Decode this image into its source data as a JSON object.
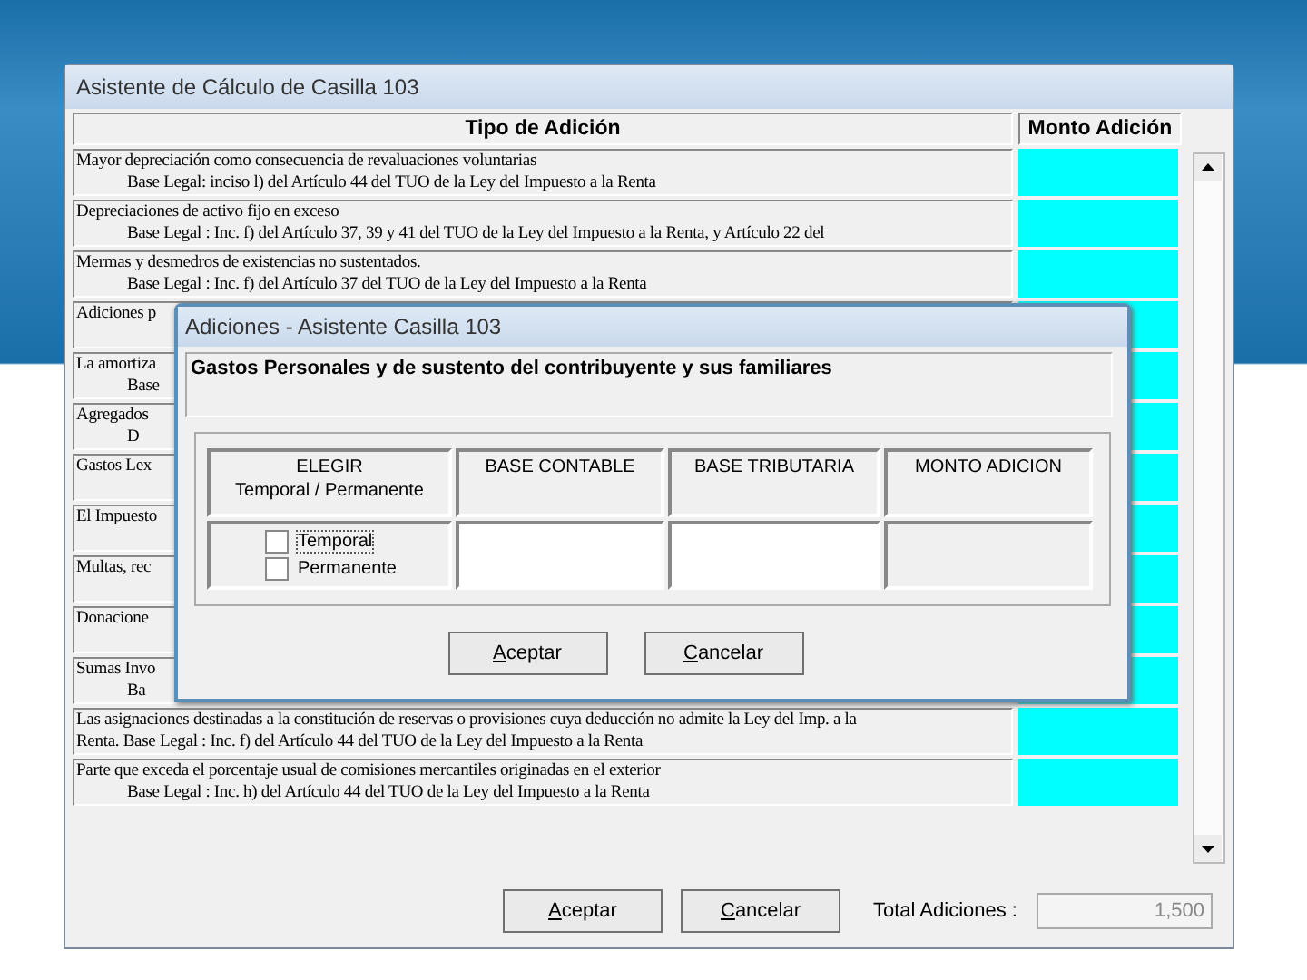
{
  "window": {
    "title": "Asistente de Cálculo de Casilla 103"
  },
  "table": {
    "columns": [
      "Tipo de Adición",
      "Monto Adición"
    ],
    "rows": [
      {
        "line1": "Mayor depreciación como consecuencia de revaluaciones voluntarias",
        "line2": "Base Legal: inciso l) del Artículo 44 del TUO de la Ley del Impuesto a la Renta",
        "flush": false
      },
      {
        "line1": "Depreciaciones de activo fijo en exceso",
        "line2": "Base Legal : Inc. f) del Artículo 37, 39 y 41 del TUO de la Ley del Impuesto a la Renta, y Artículo 22 del",
        "flush": false
      },
      {
        "line1": "Mermas y desmedros de existencias no sustentados.",
        "line2": "Base Legal : Inc. f) del Artículo 37 del TUO de la Ley del Impuesto a la Renta",
        "flush": false
      },
      {
        "line1": "Adiciones p"
      },
      {
        "line1": "La amortiza",
        "line2": "Base",
        "flush": false
      },
      {
        "line1": "Agregados",
        "line2": "D",
        "flush": false
      },
      {
        "line1": "Gastos Lex"
      },
      {
        "line1": "El Impuesto"
      },
      {
        "line1": "Multas, rec"
      },
      {
        "line1": "Donacione"
      },
      {
        "line1": "Sumas Invo",
        "line2": "Ba",
        "flush": false
      },
      {
        "line1": "Las asignaciones destinadas a la constitución de reservas o provisiones cuya deducción no admite la Ley del Imp. a la",
        "line2": "Renta.   Base Legal : Inc. f) del Artículo 44 del TUO de la Ley del Impuesto a la Renta",
        "flush": true
      },
      {
        "line1": "Parte que exceda el porcentaje usual de comisiones mercantiles originadas en el exterior",
        "line2": "Base Legal : Inc. h) del Artículo 44 del TUO de la Ley del Impuesto a la Renta",
        "flush": false
      }
    ]
  },
  "buttons": [
    "Aceptar",
    "Cancelar"
  ],
  "total": {
    "label": "Total Adiciones :",
    "value": "1,500"
  },
  "dialog": {
    "title": "Adiciones - Asistente Casilla 103",
    "heading": "Gastos Personales y de sustento del contribuyente y sus familiares",
    "columns": [
      "ELEGIR\nTemporal / Permanente",
      "BASE CONTABLE",
      "BASE TRIBUTARIA",
      "MONTO ADICION"
    ],
    "options": [
      {
        "label": "Temporal",
        "checked": false,
        "focused": true
      },
      {
        "label": "Permanente",
        "checked": false,
        "focused": false
      }
    ],
    "buttons": [
      "Aceptar",
      "Cancelar"
    ]
  }
}
